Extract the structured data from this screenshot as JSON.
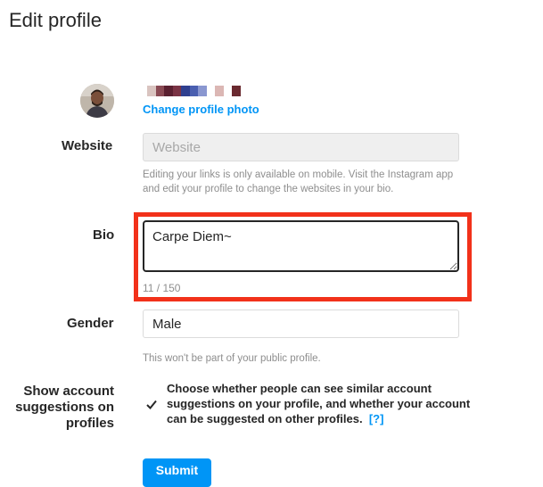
{
  "page": {
    "title": "Edit profile"
  },
  "profile": {
    "change_photo_label": "Change profile photo"
  },
  "website": {
    "label": "Website",
    "placeholder": "Website",
    "help": "Editing your links is only available on mobile. Visit the Instagram app and edit your profile to change the websites in your bio."
  },
  "bio": {
    "label": "Bio",
    "value": "Carpe Diem~",
    "counter": "11 / 150"
  },
  "gender": {
    "label": "Gender",
    "value": "Male",
    "help": "This won't be part of your public profile."
  },
  "suggestions": {
    "label": "Show account suggestions on profiles",
    "checked": true,
    "text": "Choose whether people can see similar account suggestions on your profile, and whether your account can be suggested on other profiles.",
    "help_link": "[?]"
  },
  "form": {
    "submit_label": "Submit"
  },
  "colors": {
    "accent": "#0095f6",
    "highlight": "#f2311a",
    "text": "#262626",
    "muted": "#8e8e8e",
    "border": "#dbdbdb"
  }
}
